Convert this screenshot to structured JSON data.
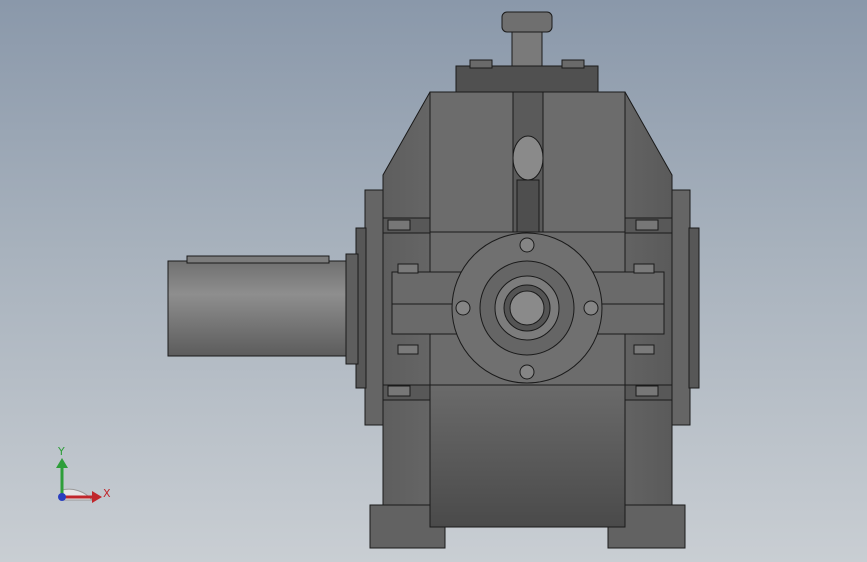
{
  "viewport": {
    "background_top": "#8a98aa",
    "background_bottom": "#c9ced3",
    "model": {
      "name": "gear-reducer",
      "body_color": "#6e6e6e",
      "dark_color": "#4c4c4c",
      "light_color": "#8c8c8c",
      "edge_color": "#1a1a1a"
    }
  },
  "triad": {
    "x_label": "X",
    "y_label": "Y",
    "x_color": "#c0262b",
    "y_color": "#2e9e3a",
    "z_color": "#2a3fbf"
  }
}
